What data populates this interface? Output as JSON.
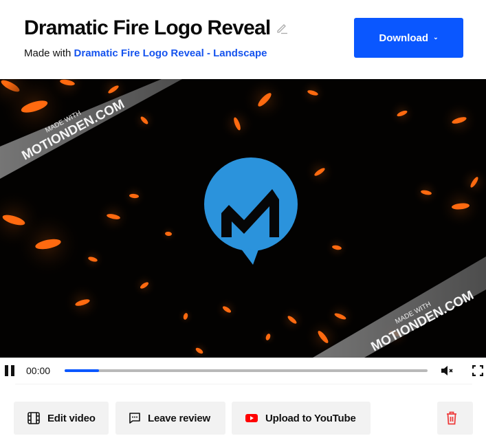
{
  "header": {
    "title": "Dramatic Fire Logo Reveal",
    "subtitle_prefix": "Made with ",
    "template_link": "Dramatic Fire Logo Reveal - Landscape",
    "download_label": "Download"
  },
  "video": {
    "watermark_top": "MADE WITH",
    "watermark_bottom": "MOTIONDEN.COM",
    "logo_color": "#2b93dc",
    "ember_color": "#ff6a10"
  },
  "player": {
    "current_time": "00:00",
    "progress_fraction": 0.095,
    "muted": true
  },
  "actions": {
    "edit_video": "Edit video",
    "leave_review": "Leave review",
    "upload_youtube": "Upload to YouTube"
  },
  "colors": {
    "accent": "#0a57ff",
    "link": "#1553ee",
    "danger": "#ee3b3b",
    "youtube": "#ff0000"
  }
}
